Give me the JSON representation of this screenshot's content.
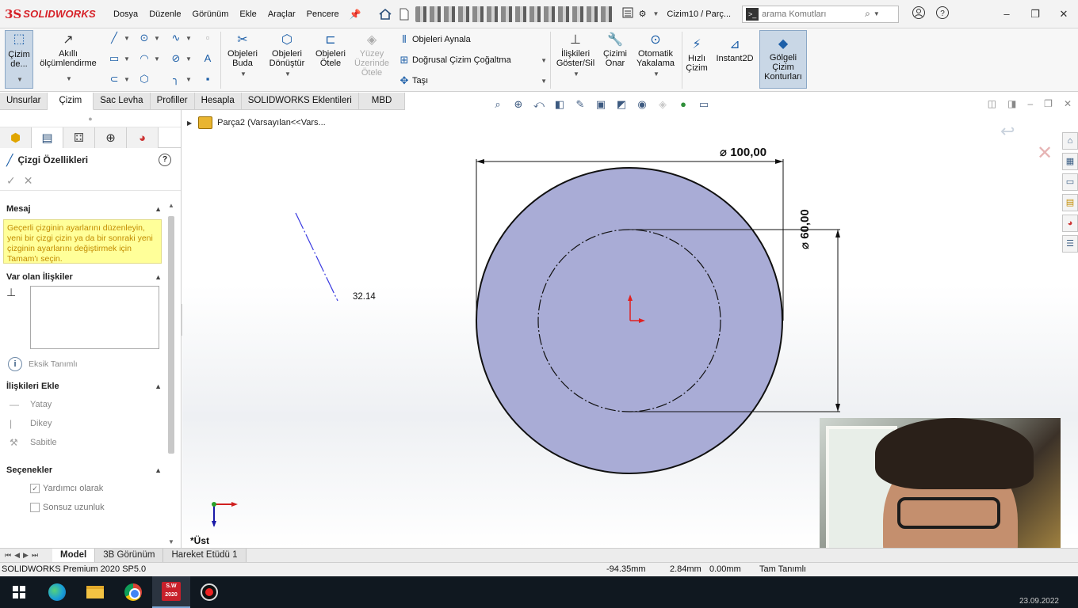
{
  "app": {
    "brand_mark": "3S",
    "brand": "SOLIDWORKS",
    "doc_title": "Cizim10 / Parç...",
    "search_placeholder": "arama Komutları"
  },
  "menu": [
    "Dosya",
    "Düzenle",
    "Görünüm",
    "Ekle",
    "Araçlar",
    "Pencere"
  ],
  "ribbon": {
    "sketch_btn": "Çizim de...",
    "smart_dim": "Akıllı ölçümlendirme",
    "trim": "Objeleri Buda",
    "convert": "Objeleri Dönüştür",
    "offset": "Objeleri Ötele",
    "offset_surface": "Yüzey Üzerinde Ötele",
    "mirror": "Objeleri Aynala",
    "linear_pattern": "Doğrusal Çizim Çoğaltma",
    "move": "Taşı",
    "relations": "İlişkileri Göster/Sil",
    "repair": "Çizimi Onar",
    "snap": "Otomatik Yakalama",
    "rapid": "Hızlı Çizim",
    "instant2d": "Instant2D",
    "shaded": "Gölgeli Çizim Konturları"
  },
  "cm_tabs": [
    "Unsurlar",
    "Çizim",
    "Sac Levha",
    "Profiller",
    "Hesapla",
    "SOLIDWORKS Eklentileri",
    "MBD"
  ],
  "panel": {
    "title": "Çizgi Özellikleri",
    "help": "?",
    "ok": "✓",
    "cancel": "✕",
    "msg_head": "Mesaj",
    "message": "Geçerli çizginin ayarlarını düzenleyin, yeni bir çizgi çizin ya da bir sonraki yeni çizginin ayarlarını değiştirmek için Tamam'ı seçin.",
    "existing_head": "Var olan İlişkiler",
    "status_text": "Eksik Tanımlı",
    "add_head": "İlişkileri Ekle",
    "rel_items": [
      "Yatay",
      "Dikey",
      "Sabitle"
    ],
    "options_head": "Seçenekler",
    "opt1": "Yardımcı olarak",
    "opt2": "Sonsuz uzunluk"
  },
  "graphics": {
    "tree_item": "Parça2  (Varsayılan<<Vars...",
    "dim_outer": "⌀ 100,00",
    "dim_inner": "⌀ 60,00",
    "line_len": "32.14",
    "view_name": "*Üst"
  },
  "bottom_tabs": [
    "Model",
    "3B Görünüm",
    "Hareket Etüdü 1"
  ],
  "status": {
    "app_version": "SOLIDWORKS Premium 2020 SP5.0",
    "x": "-94.35mm",
    "y": "2.84mm",
    "z": "0.00mm",
    "state": "Tam Tanımlı"
  },
  "taskbar": {
    "sw_label": "S.W 2020",
    "date": "23.09.2022"
  },
  "colors": {
    "brand_red": "#d62027",
    "disc_fill": "#a9acd6",
    "origin_red": "#e02020",
    "line_blue": "#3a3ae0"
  }
}
